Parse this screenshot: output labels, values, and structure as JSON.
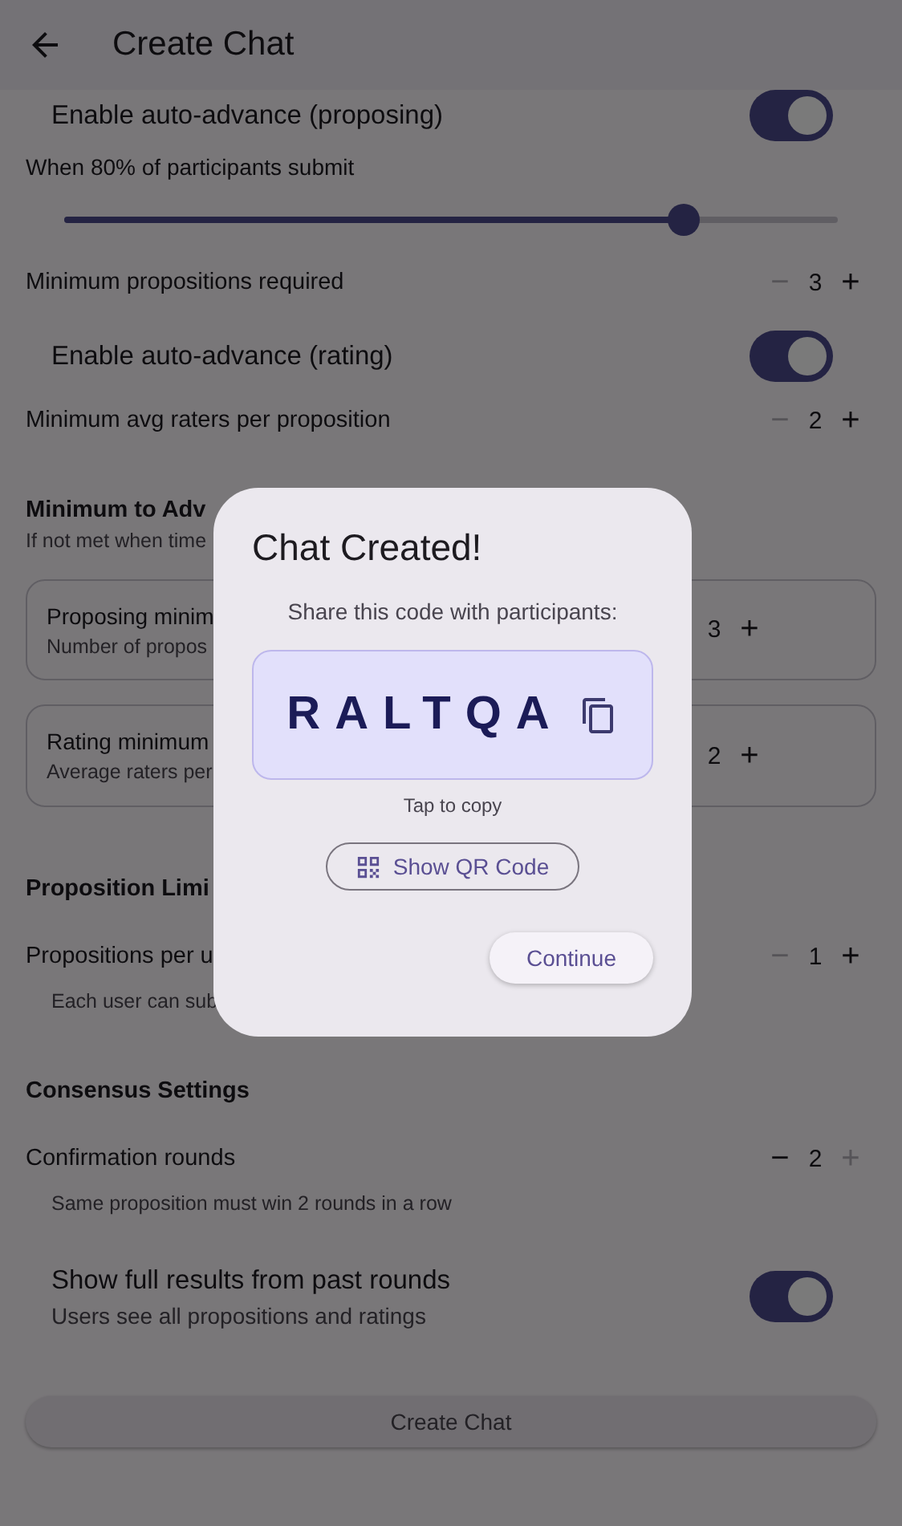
{
  "app_bar": {
    "title": "Create Chat"
  },
  "settings": [
    {
      "kind": "toggle",
      "label": "Enable auto-advance (proposing)",
      "on": true
    },
    {
      "kind": "text",
      "label": "When 80% of participants submit"
    },
    {
      "kind": "slider",
      "level": 0.8
    },
    {
      "kind": "stepper",
      "label": "Minimum propositions required",
      "minus": "−",
      "value": "3",
      "plus": "+",
      "minus_disabled": true,
      "plus_disabled": false
    },
    {
      "kind": "toggle",
      "label": "Enable auto-advance (rating)",
      "on": true
    },
    {
      "kind": "stepper",
      "label": "Minimum avg raters per proposition",
      "minus": "−",
      "value": "2",
      "plus": "+",
      "minus_disabled": true,
      "plus_disabled": false
    },
    {
      "kind": "section",
      "title": "Minimum to Adv",
      "subtitle": "If not met when time"
    },
    {
      "kind": "card",
      "label": "Proposing minim",
      "caption": "Number of propos",
      "value": "3",
      "plus": "+",
      "plus_disabled": false
    },
    {
      "kind": "card",
      "label": "Rating minimum",
      "caption": "Average raters per",
      "value": "2",
      "plus": "+",
      "plus_disabled": false
    },
    {
      "kind": "section",
      "title": "Proposition Limi"
    },
    {
      "kind": "stepper",
      "label": "Propositions per u",
      "minus": "−",
      "value": "1",
      "plus": "+",
      "minus_disabled": true,
      "plus_disabled": false
    },
    {
      "kind": "note",
      "label": "Each user can sub"
    },
    {
      "kind": "section",
      "title": "Consensus Settings"
    },
    {
      "kind": "stepper",
      "label": "Confirmation rounds",
      "minus": "−",
      "value": "2",
      "plus": "+",
      "minus_disabled": false,
      "plus_disabled": true
    },
    {
      "kind": "note",
      "label": "Same proposition must win 2 rounds in a row"
    },
    {
      "kind": "toggle",
      "label": "Show full results from past rounds",
      "caption": "Users see all propositions and ratings",
      "on": true
    },
    {
      "kind": "button",
      "label": "Create Chat"
    }
  ],
  "dialog": {
    "title": "Chat Created!",
    "prompt": "Share this code with participants:",
    "code": "RALTQA",
    "hint": "Tap to copy",
    "qr_button": "Show QR Code",
    "continue_button": "Continue"
  }
}
